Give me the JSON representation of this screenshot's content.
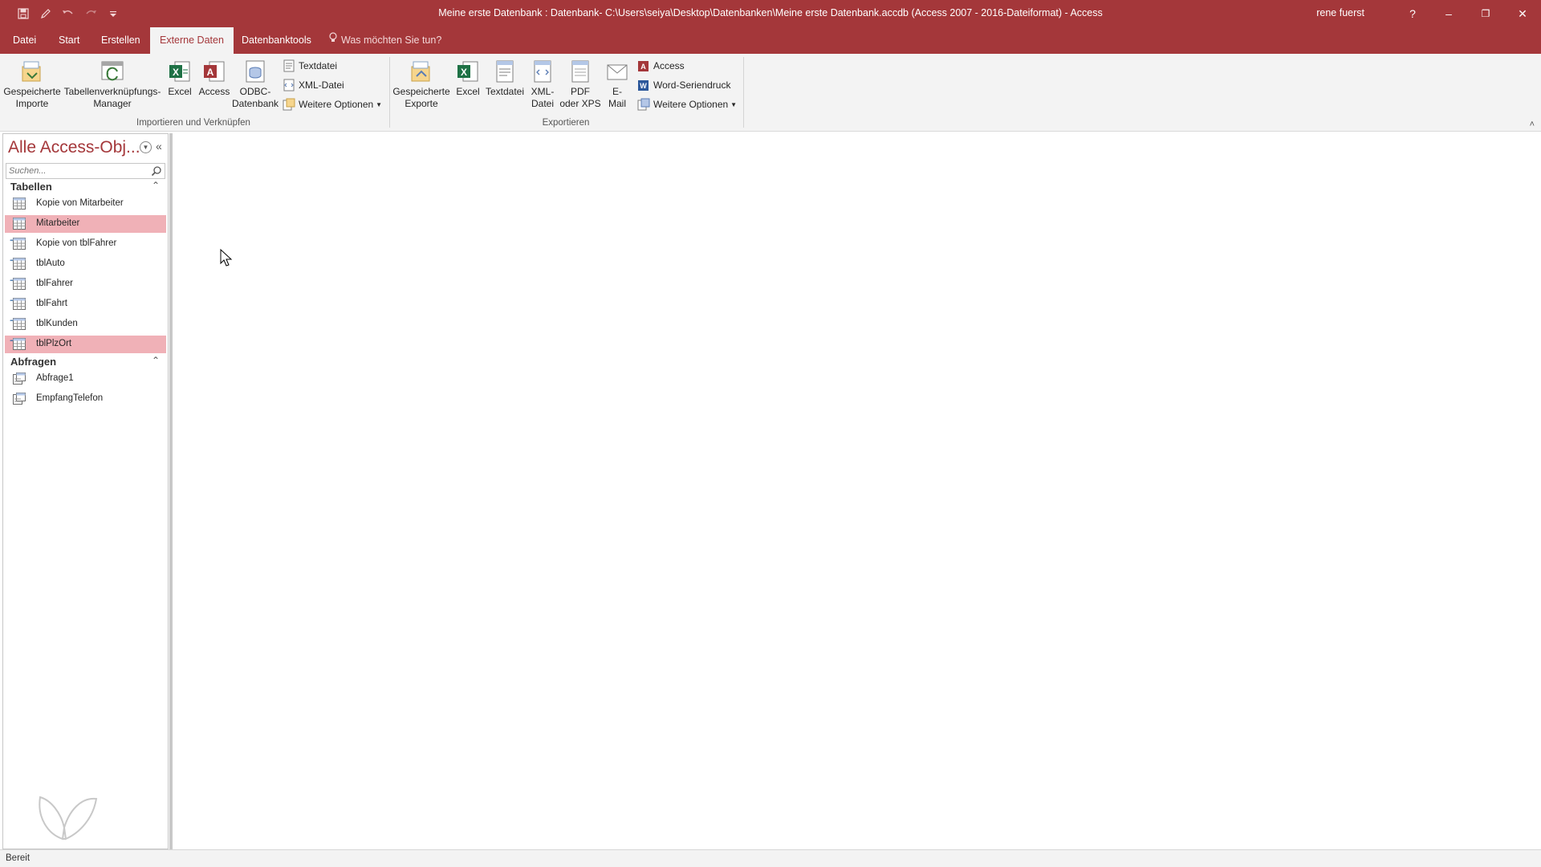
{
  "titlebar": {
    "title": "Meine erste Datenbank : Datenbank- C:\\Users\\seiya\\Desktop\\Datenbanken\\Meine erste Datenbank.accdb (Access 2007 - 2016-Dateiformat)  -  Access",
    "user": "rene fuerst",
    "help": "?",
    "minimize": "–",
    "restore": "❐",
    "close": "✕",
    "qat_icons": [
      "save-icon",
      "edit-icon",
      "undo-icon",
      "redo-icon",
      "customize-icon"
    ]
  },
  "tabs": [
    {
      "label": "Datei",
      "active": false
    },
    {
      "label": "Start",
      "active": false
    },
    {
      "label": "Erstellen",
      "active": false
    },
    {
      "label": "Externe Daten",
      "active": true
    },
    {
      "label": "Datenbanktools",
      "active": false
    }
  ],
  "tellme": "Was möchten Sie tun?",
  "ribbon": {
    "import_group": {
      "label": "Importieren und Verknüpfen",
      "saved_imports": [
        "Gespeicherte",
        "Importe"
      ],
      "link_manager": [
        "Tabellenverknüpfungs-",
        "Manager"
      ],
      "excel": "Excel",
      "access": "Access",
      "odbc": [
        "ODBC-",
        "Datenbank"
      ],
      "textfile": "Textdatei",
      "xmlfile": "XML-Datei",
      "more": "Weitere Optionen"
    },
    "export_group": {
      "label": "Exportieren",
      "saved_exports": [
        "Gespeicherte",
        "Exporte"
      ],
      "excel": "Excel",
      "textfile": "Textdatei",
      "xmlfile": [
        "XML-",
        "Datei"
      ],
      "pdf": [
        "PDF",
        "oder XPS"
      ],
      "email": [
        "E-",
        "Mail"
      ],
      "access": "Access",
      "word_merge": "Word-Seriendruck",
      "more": "Weitere Optionen"
    },
    "collapse": "˄"
  },
  "nav": {
    "title": "Alle Access-Obj...",
    "search_placeholder": "Suchen...",
    "groups": [
      {
        "label": "Tabellen",
        "items": [
          {
            "label": "Kopie von Mitarbeiter",
            "linked": false,
            "selected": false
          },
          {
            "label": "Mitarbeiter",
            "linked": false,
            "selected": true
          },
          {
            "label": "Kopie von tblFahrer",
            "linked": true,
            "selected": false
          },
          {
            "label": "tblAuto",
            "linked": true,
            "selected": false
          },
          {
            "label": "tblFahrer",
            "linked": true,
            "selected": false
          },
          {
            "label": "tblFahrt",
            "linked": true,
            "selected": false
          },
          {
            "label": "tblKunden",
            "linked": true,
            "selected": false
          },
          {
            "label": "tblPlzOrt",
            "linked": true,
            "selected": true
          }
        ]
      },
      {
        "label": "Abfragen",
        "items": [
          {
            "label": "Abfrage1"
          },
          {
            "label": "EmpfangTelefon"
          }
        ]
      }
    ]
  },
  "status": "Bereit",
  "colors": {
    "accent": "#a4373a",
    "selection": "#f0b1b7",
    "ribbon_bg": "#f3f3f3"
  }
}
